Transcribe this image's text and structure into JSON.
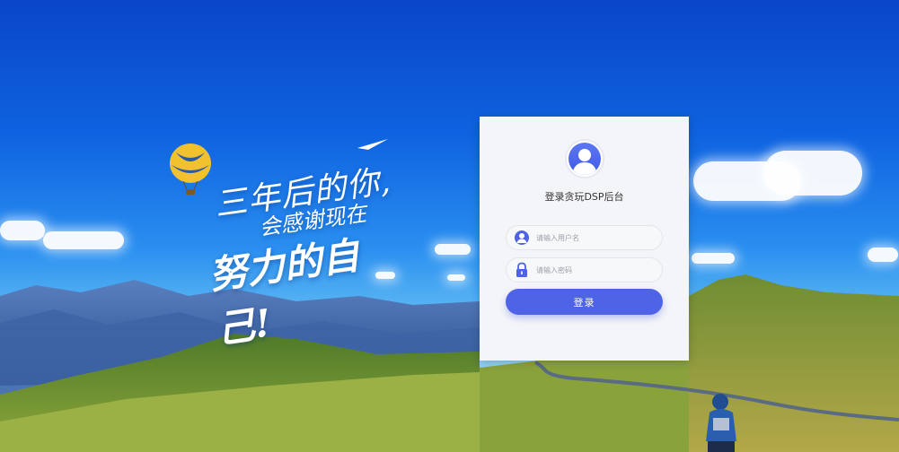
{
  "slogan": {
    "line1": "三年后的你,",
    "line2": "会感谢现在",
    "line3": "努力的自己!"
  },
  "login": {
    "title": "登录贪玩DSP后台",
    "username_placeholder": "请输入用户名",
    "password_placeholder": "请输入密码",
    "submit_label": "登录"
  },
  "icons": {
    "avatar": "user-avatar-icon",
    "username": "user-icon",
    "password": "lock-icon"
  },
  "colors": {
    "accent": "#4f63e6",
    "card_bg": "#f4f5f8",
    "sky_top": "#0a46c9"
  }
}
